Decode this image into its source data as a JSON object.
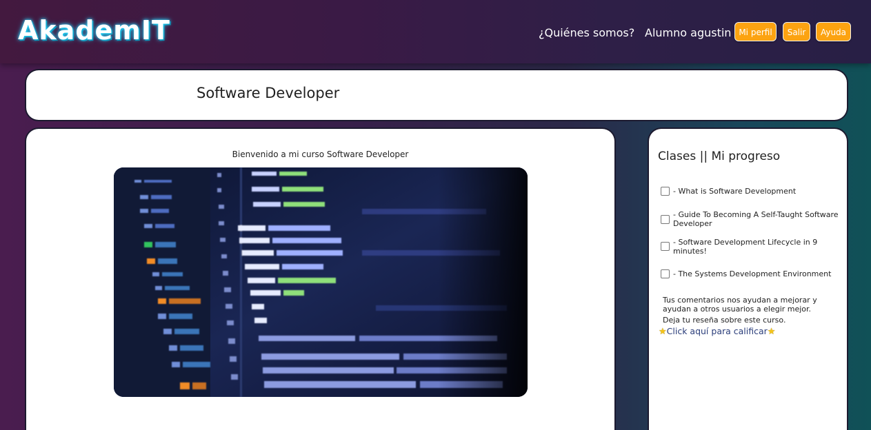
{
  "header": {
    "logo": "AkademIT",
    "about_link": "¿Quiénes somos?",
    "user_label": "Alumno agustin",
    "profile_button": "Mi perfil",
    "logout_button": "Salir",
    "help_button": "Ayuda"
  },
  "course": {
    "title": "Software Developer",
    "welcome": "Bienvenido a mi curso Software Developer"
  },
  "sidebar": {
    "title": "Clases || Mi progreso",
    "lessons": [
      {
        "label": "- What is Software Development",
        "checked": false
      },
      {
        "label": "- Guide To Becoming A Self-Taught Software Developer",
        "checked": false
      },
      {
        "label": "- Software Development Lifecycle in 9 minutes!",
        "checked": false
      },
      {
        "label": "- The Systems Development Environment",
        "checked": false
      }
    ],
    "comment_text": "Tus comentarios nos ayudan a mejorar y ayudan a otros usuarios a elegir mejor.",
    "review_prompt": "Deja tu reseña sobre este curso.",
    "rate_link": "Click aquí para calificar"
  },
  "colors": {
    "accent": "#fca311",
    "logo_glow": "#28d7ff",
    "link": "#2a3d7a",
    "star": "#f5c518"
  },
  "icons": {
    "rate_star": "star-icon"
  }
}
